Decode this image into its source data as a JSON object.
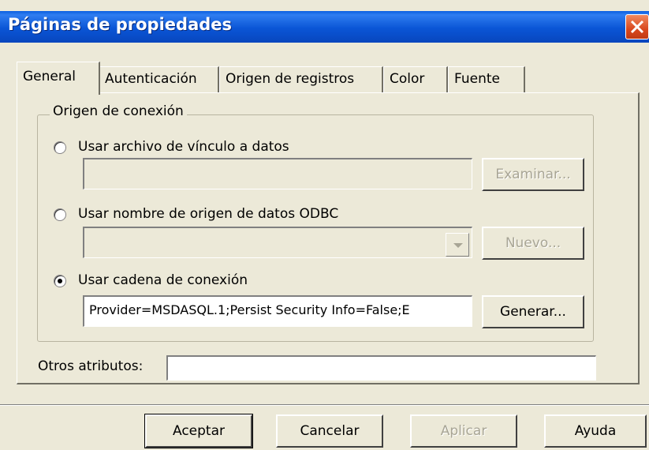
{
  "window": {
    "title": "Páginas de propiedades"
  },
  "tabs": [
    {
      "label": "General",
      "active": true
    },
    {
      "label": "Autenticación"
    },
    {
      "label": "Origen de registros"
    },
    {
      "label": "Color"
    },
    {
      "label": "Fuente"
    }
  ],
  "general": {
    "group_title": "Origen de conexión",
    "option_link_file": {
      "label": "Usar archivo de vínculo a datos",
      "selected": false,
      "value": "",
      "browse_button": "Examinar..."
    },
    "option_odbc": {
      "label": "Usar nombre de origen de datos ODBC",
      "selected": false,
      "value": "",
      "new_button": "Nuevo..."
    },
    "option_connection_string": {
      "label": "Usar cadena de conexión",
      "selected": true,
      "value": "Provider=MSDASQL.1;Persist Security Info=False;E",
      "build_button": "Generar..."
    },
    "other_attributes": {
      "label": "Otros atributos:",
      "value": ""
    }
  },
  "footer": {
    "ok": "Aceptar",
    "cancel": "Cancelar",
    "apply": "Aplicar",
    "help": "Ayuda"
  },
  "colors": {
    "titlebar": "#0a55d6",
    "close": "#d9481e",
    "face": "#ece9d8"
  }
}
